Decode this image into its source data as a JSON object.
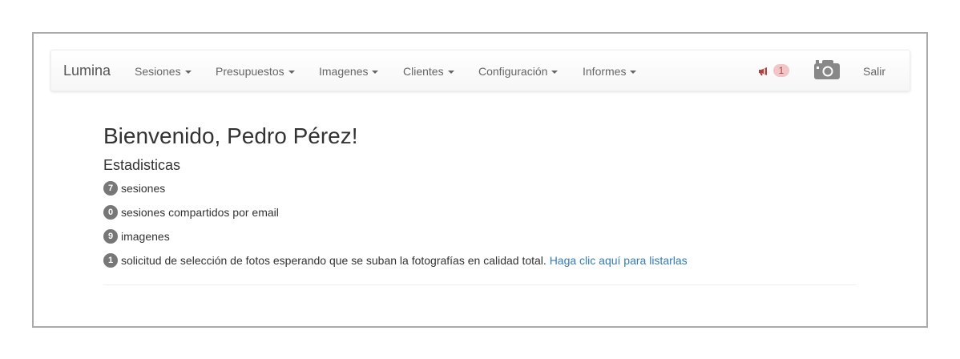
{
  "navbar": {
    "brand": "Lumina",
    "menus": [
      {
        "label": "Sesiones"
      },
      {
        "label": "Presupuestos"
      },
      {
        "label": "Imagenes"
      },
      {
        "label": "Clientes"
      },
      {
        "label": "Configuración"
      },
      {
        "label": "Informes"
      }
    ],
    "notification_count": "1",
    "logout_label": "Salir",
    "icons": {
      "notification": "bullhorn-icon",
      "camera": "camera-icon"
    },
    "notification_color": "#a94442"
  },
  "main": {
    "heading": "Bienvenido, Pedro Pérez!",
    "subheading": "Estadisticas",
    "stats": [
      {
        "count": "7",
        "text": "sesiones"
      },
      {
        "count": "0",
        "text": "sesiones compartidos por email"
      },
      {
        "count": "9",
        "text": "imagenes"
      },
      {
        "count": "1",
        "text": "solicitud de selección de fotos esperando que se suban la fotografías en calidad total.",
        "link": "Haga clic aquí para listarlas"
      }
    ]
  },
  "colors": {
    "link": "#337ab7",
    "badge": "#777777"
  }
}
